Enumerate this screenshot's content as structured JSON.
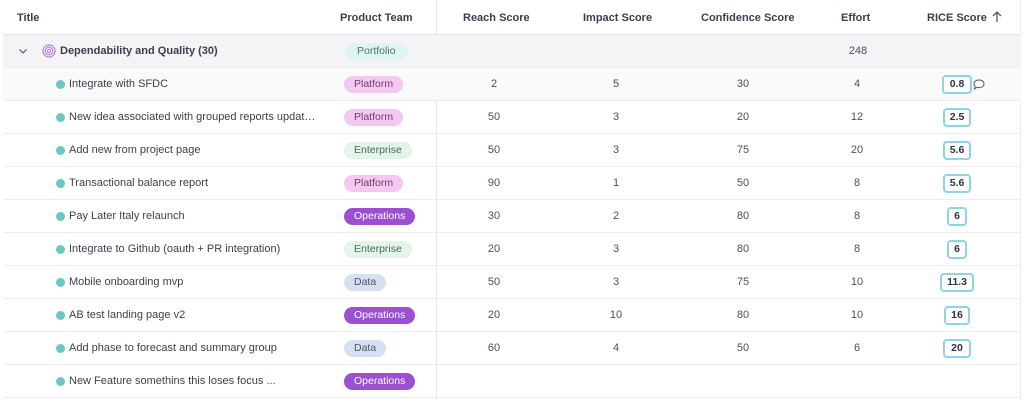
{
  "columns": {
    "title": "Title",
    "product_team": "Product Team",
    "reach": "Reach Score",
    "impact": "Impact Score",
    "confidence": "Confidence Score",
    "effort": "Effort",
    "rice": "RICE Score"
  },
  "group": {
    "title": "Dependability and Quality (30)",
    "team": "Portfolio",
    "effort": "248"
  },
  "team_colors": {
    "Portfolio": {
      "bg": "#dff5f3",
      "fg": "#4f6f6b"
    },
    "Platform": {
      "bg": "#f4c8f1",
      "fg": "#6e3f6c"
    },
    "Enterprise": {
      "bg": "#e3f4ea",
      "fg": "#4d6a58"
    },
    "Operations": {
      "bg": "#9b4fd1",
      "fg": "#ffffff"
    },
    "Data": {
      "bg": "#d8dff1",
      "fg": "#4a5572"
    }
  },
  "rows": [
    {
      "title": "Integrate with SFDC",
      "team": "Platform",
      "reach": "2",
      "impact": "5",
      "confidence": "30",
      "effort": "4",
      "rice": "0.8"
    },
    {
      "title": "New idea associated with grouped reports updated i...",
      "team": "Platform",
      "reach": "50",
      "impact": "3",
      "confidence": "20",
      "effort": "12",
      "rice": "2.5"
    },
    {
      "title": "Add new from project page",
      "team": "Enterprise",
      "reach": "50",
      "impact": "3",
      "confidence": "75",
      "effort": "20",
      "rice": "5.6"
    },
    {
      "title": "Transactional balance report",
      "team": "Platform",
      "reach": "90",
      "impact": "1",
      "confidence": "50",
      "effort": "8",
      "rice": "5.6"
    },
    {
      "title": "Pay Later Italy relaunch",
      "team": "Operations",
      "reach": "30",
      "impact": "2",
      "confidence": "80",
      "effort": "8",
      "rice": "6"
    },
    {
      "title": "Integrate to Github (oauth + PR integration)",
      "team": "Enterprise",
      "reach": "20",
      "impact": "3",
      "confidence": "80",
      "effort": "8",
      "rice": "6"
    },
    {
      "title": "Mobile onboarding mvp",
      "team": "Data",
      "reach": "50",
      "impact": "3",
      "confidence": "75",
      "effort": "10",
      "rice": "11.3"
    },
    {
      "title": "AB test landing page  v2",
      "team": "Operations",
      "reach": "20",
      "impact": "10",
      "confidence": "80",
      "effort": "10",
      "rice": "16"
    },
    {
      "title": "Add phase to forecast and summary group",
      "team": "Data",
      "reach": "60",
      "impact": "4",
      "confidence": "50",
      "effort": "6",
      "rice": "20"
    },
    {
      "title": "New Feature somethins this loses focus ...",
      "team": "Operations",
      "reach": "",
      "impact": "",
      "confidence": "",
      "effort": "",
      "rice": ""
    }
  ]
}
